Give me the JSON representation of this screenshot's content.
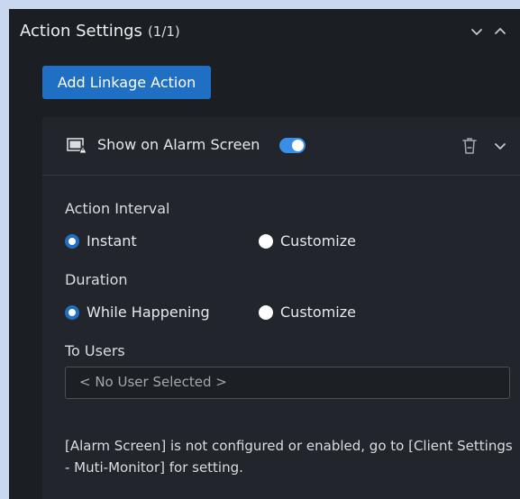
{
  "section": {
    "title": "Action Settings",
    "count": "(1/1)"
  },
  "add_button": {
    "label": "Add Linkage Action"
  },
  "action_card": {
    "title": "Show on Alarm Screen",
    "toggle_on": true,
    "action_interval": {
      "label": "Action Interval",
      "options": [
        "Instant",
        "Customize"
      ],
      "selected": "Instant"
    },
    "duration": {
      "label": "Duration",
      "options": [
        "While Happening",
        "Customize"
      ],
      "selected": "While Happening"
    },
    "to_users": {
      "label": "To Users",
      "value": "< No User Selected >"
    },
    "note": "[Alarm Screen] is not configured or enabled, go to [Client Settings - Muti-Monitor] for setting."
  },
  "colors": {
    "accent": "#1f6fc4",
    "toggle": "#3a8ee6",
    "panel_bg": "#1b1e23",
    "card_bg": "#22262c"
  }
}
